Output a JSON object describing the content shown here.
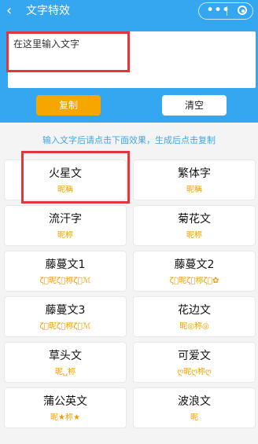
{
  "nav": {
    "back_icon": "chevron-left-icon",
    "title": "文字特效",
    "more_icon": "more-icon",
    "target_icon": "target-icon"
  },
  "input": {
    "placeholder": "在这里输入文字"
  },
  "buttons": {
    "copy": "复制",
    "clear": "清空"
  },
  "hint": "输入文字后请点击下面效果，生成后点击复制",
  "colors": {
    "header_blue": "#35a6f0",
    "accent_orange": "#f7a600",
    "hint_blue": "#3fa7e2",
    "highlight_red": "#e2363c"
  },
  "effects": [
    {
      "name": "火星文",
      "sample": "昵稱"
    },
    {
      "name": "繁体字",
      "sample": "昵稱"
    },
    {
      "name": "流汗字",
      "sample": "昵称"
    },
    {
      "name": "菊花文",
      "sample": "昵称"
    },
    {
      "name": "藤蔓文1",
      "sample": "ζั͡昵ζั͡称ζั͡ℳ"
    },
    {
      "name": "藤蔓文2",
      "sample": "ζั͡昵ζั͡称ζั͡✿"
    },
    {
      "name": "藤蔓文3",
      "sample": "ζั͡昵ζั͡称ζั͡ℳ"
    },
    {
      "name": "花边文",
      "sample": "昵◎称◎"
    },
    {
      "name": "草头文",
      "sample": "昵␣称"
    },
    {
      "name": "可爱文",
      "sample": "ღ昵ღ称ღ"
    },
    {
      "name": "蒲公英文",
      "sample": "昵★称★"
    },
    {
      "name": "波浪文",
      "sample": "昵"
    }
  ]
}
